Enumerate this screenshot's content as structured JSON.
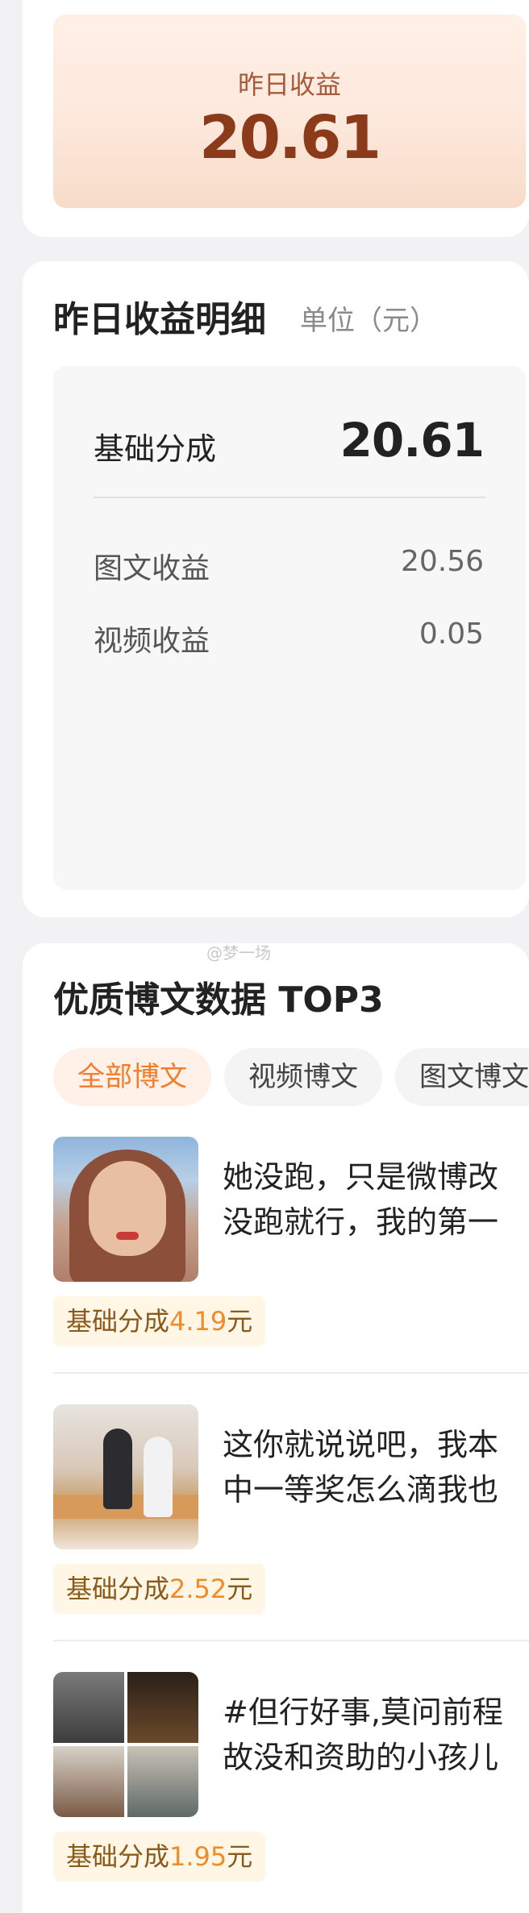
{
  "summary": {
    "title": "昨日收益",
    "value": "20.61"
  },
  "detail": {
    "title": "昨日收益明细",
    "unit": "单位（元）",
    "base": {
      "label": "基础分成",
      "value": "20.61"
    },
    "rows": [
      {
        "label": "图文收益",
        "value": "20.56"
      },
      {
        "label": "视频收益",
        "value": "0.05"
      }
    ]
  },
  "top3": {
    "watermark": "@梦一场",
    "title": "优质博文数据 TOP3",
    "tabs": [
      {
        "label": "全部博文",
        "active": true
      },
      {
        "label": "视频博文",
        "active": false
      },
      {
        "label": "图文博文",
        "active": false
      }
    ],
    "posts": [
      {
        "line1": "她没跑，只是微博改",
        "line2": "没跑就行，我的第一",
        "badge_prefix": "基础分成",
        "badge_amount": "4.19",
        "badge_suffix": "元"
      },
      {
        "line1": "这你就说说吧，我本",
        "line2": "中一等奖怎么滴我也",
        "badge_prefix": "基础分成",
        "badge_amount": "2.52",
        "badge_suffix": "元"
      },
      {
        "line1": "#但行好事,莫问前程",
        "line2": "故没和资助的小孩儿",
        "badge_prefix": "基础分成",
        "badge_amount": "1.95",
        "badge_suffix": "元"
      }
    ]
  }
}
